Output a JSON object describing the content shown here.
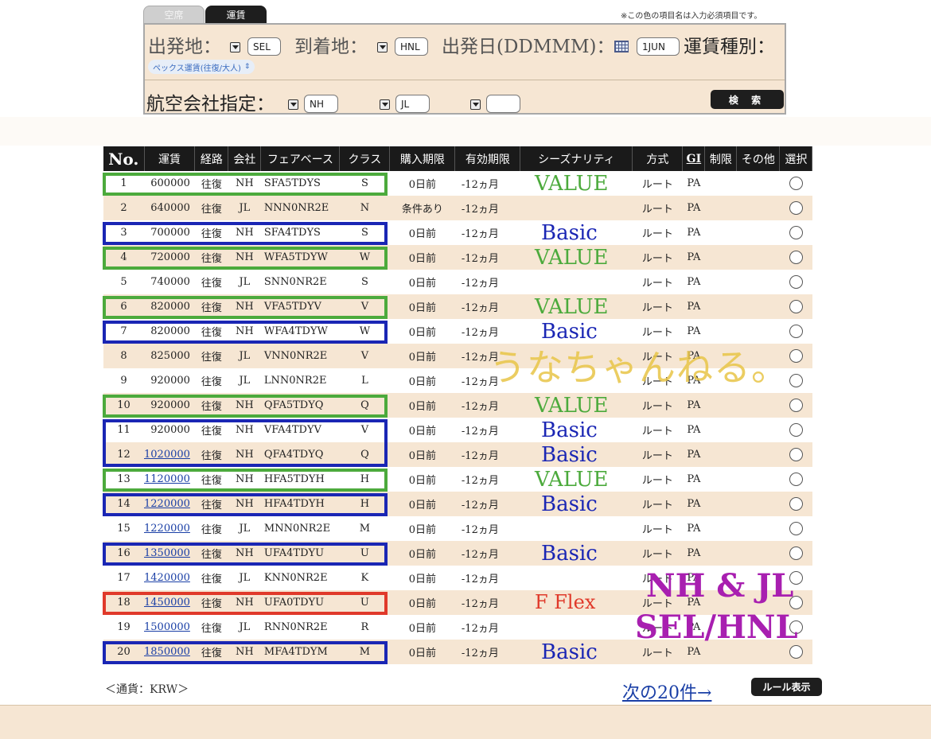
{
  "tabs": [
    {
      "label": "空席"
    },
    {
      "label": "運賃"
    }
  ],
  "required_note": "※この色の項目名は入力必須項目です。",
  "search": {
    "origin_label": "出発地：",
    "origin_value": "SEL",
    "destination_label": "到着地：",
    "destination_value": "HNL",
    "date_label": "出発日(DDMMM)：",
    "date_value": "1JUN",
    "fare_type_label": "運賃種別：",
    "fare_type_value": "ペックス運賃(往復/大人)",
    "airline_label": "航空会社指定：",
    "airline_1": "NH",
    "airline_2": "JL",
    "airline_3": "",
    "search_button": "検 索"
  },
  "table": {
    "headers": [
      "No.",
      "運賃",
      "経路",
      "会社",
      "フェアベース",
      "クラス",
      "購入期限",
      "有効期限",
      "シーズナリティ",
      "方式",
      "GI",
      "制限",
      "その他",
      "選択"
    ],
    "rows": [
      {
        "no": "1",
        "fare": "600000",
        "linked": false,
        "route": "往復",
        "carrier": "NH",
        "farebase": "SFA5TDYS",
        "class": "S",
        "purchase": "0日前",
        "validity": "-12ヵ月",
        "method": "ルート",
        "gi": "PA"
      },
      {
        "no": "2",
        "fare": "640000",
        "linked": false,
        "route": "往復",
        "carrier": "JL",
        "farebase": "NNN0NR2E",
        "class": "N",
        "purchase": "条件あり",
        "validity": "-12ヵ月",
        "method": "ルート",
        "gi": "PA"
      },
      {
        "no": "3",
        "fare": "700000",
        "linked": false,
        "route": "往復",
        "carrier": "NH",
        "farebase": "SFA4TDYS",
        "class": "S",
        "purchase": "0日前",
        "validity": "-12ヵ月",
        "method": "ルート",
        "gi": "PA"
      },
      {
        "no": "4",
        "fare": "720000",
        "linked": false,
        "route": "往復",
        "carrier": "NH",
        "farebase": "WFA5TDYW",
        "class": "W",
        "purchase": "0日前",
        "validity": "-12ヵ月",
        "method": "ルート",
        "gi": "PA"
      },
      {
        "no": "5",
        "fare": "740000",
        "linked": false,
        "route": "往復",
        "carrier": "JL",
        "farebase": "SNN0NR2E",
        "class": "S",
        "purchase": "0日前",
        "validity": "-12ヵ月",
        "method": "ルート",
        "gi": "PA"
      },
      {
        "no": "6",
        "fare": "820000",
        "linked": false,
        "route": "往復",
        "carrier": "NH",
        "farebase": "VFA5TDYV",
        "class": "V",
        "purchase": "0日前",
        "validity": "-12ヵ月",
        "method": "ルート",
        "gi": "PA"
      },
      {
        "no": "7",
        "fare": "820000",
        "linked": false,
        "route": "往復",
        "carrier": "NH",
        "farebase": "WFA4TDYW",
        "class": "W",
        "purchase": "0日前",
        "validity": "-12ヵ月",
        "method": "ルート",
        "gi": "PA"
      },
      {
        "no": "8",
        "fare": "825000",
        "linked": false,
        "route": "往復",
        "carrier": "JL",
        "farebase": "VNN0NR2E",
        "class": "V",
        "purchase": "0日前",
        "validity": "-12ヵ月",
        "method": "ルート",
        "gi": "PA"
      },
      {
        "no": "9",
        "fare": "920000",
        "linked": false,
        "route": "往復",
        "carrier": "JL",
        "farebase": "LNN0NR2E",
        "class": "L",
        "purchase": "0日前",
        "validity": "-12ヵ月",
        "method": "ルート",
        "gi": "PA"
      },
      {
        "no": "10",
        "fare": "920000",
        "linked": false,
        "route": "往復",
        "carrier": "NH",
        "farebase": "QFA5TDYQ",
        "class": "Q",
        "purchase": "0日前",
        "validity": "-12ヵ月",
        "method": "ルート",
        "gi": "PA"
      },
      {
        "no": "11",
        "fare": "920000",
        "linked": false,
        "route": "往復",
        "carrier": "NH",
        "farebase": "VFA4TDYV",
        "class": "V",
        "purchase": "0日前",
        "validity": "-12ヵ月",
        "method": "ルート",
        "gi": "PA"
      },
      {
        "no": "12",
        "fare": "1020000",
        "linked": true,
        "route": "往復",
        "carrier": "NH",
        "farebase": "QFA4TDYQ",
        "class": "Q",
        "purchase": "0日前",
        "validity": "-12ヵ月",
        "method": "ルート",
        "gi": "PA"
      },
      {
        "no": "13",
        "fare": "1120000",
        "linked": true,
        "route": "往復",
        "carrier": "NH",
        "farebase": "HFA5TDYH",
        "class": "H",
        "purchase": "0日前",
        "validity": "-12ヵ月",
        "method": "ルート",
        "gi": "PA"
      },
      {
        "no": "14",
        "fare": "1220000",
        "linked": true,
        "route": "往復",
        "carrier": "NH",
        "farebase": "HFA4TDYH",
        "class": "H",
        "purchase": "0日前",
        "validity": "-12ヵ月",
        "method": "ルート",
        "gi": "PA"
      },
      {
        "no": "15",
        "fare": "1220000",
        "linked": true,
        "route": "往復",
        "carrier": "JL",
        "farebase": "MNN0NR2E",
        "class": "M",
        "purchase": "0日前",
        "validity": "-12ヵ月",
        "method": "ルート",
        "gi": "PA"
      },
      {
        "no": "16",
        "fare": "1350000",
        "linked": true,
        "route": "往復",
        "carrier": "NH",
        "farebase": "UFA4TDYU",
        "class": "U",
        "purchase": "0日前",
        "validity": "-12ヵ月",
        "method": "ルート",
        "gi": "PA"
      },
      {
        "no": "17",
        "fare": "1420000",
        "linked": true,
        "route": "往復",
        "carrier": "JL",
        "farebase": "KNN0NR2E",
        "class": "K",
        "purchase": "0日前",
        "validity": "-12ヵ月",
        "method": "ルート",
        "gi": "PA"
      },
      {
        "no": "18",
        "fare": "1450000",
        "linked": true,
        "route": "往復",
        "carrier": "NH",
        "farebase": "UFA0TDYU",
        "class": "U",
        "purchase": "0日前",
        "validity": "-12ヵ月",
        "method": "ルート",
        "gi": "PA"
      },
      {
        "no": "19",
        "fare": "1500000",
        "linked": true,
        "route": "往復",
        "carrier": "JL",
        "farebase": "RNN0NR2E",
        "class": "R",
        "purchase": "0日前",
        "validity": "-12ヵ月",
        "method": "ルート",
        "gi": "PA"
      },
      {
        "no": "20",
        "fare": "1850000",
        "linked": true,
        "route": "往復",
        "carrier": "NH",
        "farebase": "MFA4TDYM",
        "class": "M",
        "purchase": "0日前",
        "validity": "-12ヵ月",
        "method": "ルート",
        "gi": "PA"
      }
    ]
  },
  "annotations": {
    "colors": {
      "value": "#4caa3c",
      "basic": "#1a26b4",
      "flex": "#e0392a"
    },
    "labels": [
      {
        "row": 1,
        "text": "VALUE",
        "kind": "value"
      },
      {
        "row": 3,
        "text": "Basic",
        "kind": "basic"
      },
      {
        "row": 4,
        "text": "VALUE",
        "kind": "value"
      },
      {
        "row": 6,
        "text": "VALUE",
        "kind": "value"
      },
      {
        "row": 7,
        "text": "Basic",
        "kind": "basic"
      },
      {
        "row": 10,
        "text": "VALUE",
        "kind": "value"
      },
      {
        "row": 11,
        "text": "Basic",
        "kind": "basic"
      },
      {
        "row": 12,
        "text": "Basic",
        "kind": "basic"
      },
      {
        "row": 13,
        "text": "VALUE",
        "kind": "value"
      },
      {
        "row": 14,
        "text": "Basic",
        "kind": "basic"
      },
      {
        "row": 16,
        "text": "Basic",
        "kind": "basic"
      },
      {
        "row": 18,
        "text": "F Flex",
        "kind": "flex"
      },
      {
        "row": 20,
        "text": "Basic",
        "kind": "basic"
      }
    ],
    "boxes": [
      {
        "rows": [
          1
        ],
        "kind": "value"
      },
      {
        "rows": [
          3
        ],
        "kind": "basic"
      },
      {
        "rows": [
          4
        ],
        "kind": "value"
      },
      {
        "rows": [
          6
        ],
        "kind": "value"
      },
      {
        "rows": [
          7
        ],
        "kind": "basic"
      },
      {
        "rows": [
          10
        ],
        "kind": "value"
      },
      {
        "rows": [
          11,
          12
        ],
        "kind": "basic"
      },
      {
        "rows": [
          13
        ],
        "kind": "value"
      },
      {
        "rows": [
          14
        ],
        "kind": "basic"
      },
      {
        "rows": [
          16
        ],
        "kind": "basic"
      },
      {
        "rows": [
          18
        ],
        "kind": "flex"
      },
      {
        "rows": [
          20
        ],
        "kind": "basic"
      }
    ],
    "watermark": "うなちゃんねる。",
    "route_line1": "NH & JL",
    "route_line2": "SEL/HNL"
  },
  "footer": {
    "currency": "＜通貨：KRW＞",
    "next_link": "次の20件→",
    "rule_button": "ルール表示"
  }
}
